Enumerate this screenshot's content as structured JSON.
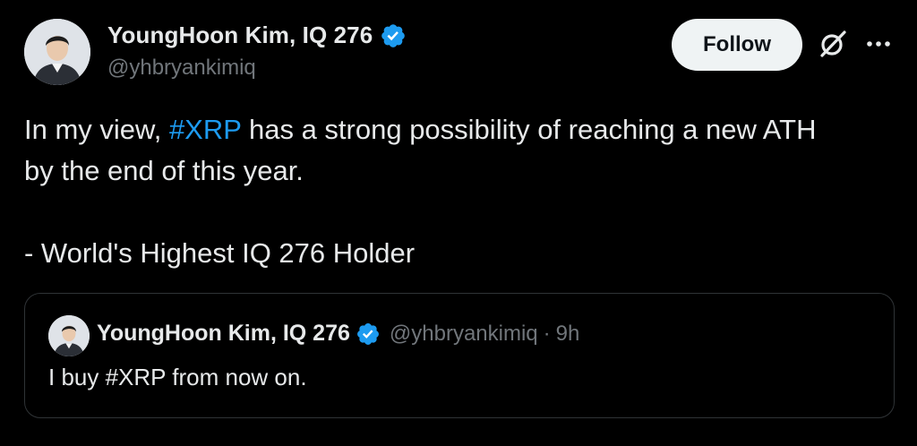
{
  "author": {
    "display_name": "YoungHoon Kim, IQ 276",
    "handle": "@yhbryankimiq",
    "avatar_icon": "profile-photo",
    "verified_icon": "verified-badge-icon"
  },
  "actions": {
    "follow_label": "Follow",
    "grok_icon": "grok-icon",
    "more_icon": "more-options-icon"
  },
  "tweet": {
    "line1_before": "In my view, ",
    "line1_hashtag": "#XRP",
    "line1_after": " has a strong possibility of reaching a new ATH",
    "line2": "by the end of this year.",
    "line3": "- World's Highest IQ 276 Holder"
  },
  "quote": {
    "display_name": "YoungHoon Kim, IQ 276",
    "handle": "@yhbryankimiq",
    "separator": "·",
    "time": "9h",
    "text": "I buy #XRP from now on."
  },
  "colors": {
    "background": "#000000",
    "text": "#e7e9ea",
    "secondary": "#71767b",
    "link": "#1d9bf0",
    "verified": "#1d9bf0",
    "follow_bg": "#eff3f4",
    "border": "#2f3336"
  }
}
